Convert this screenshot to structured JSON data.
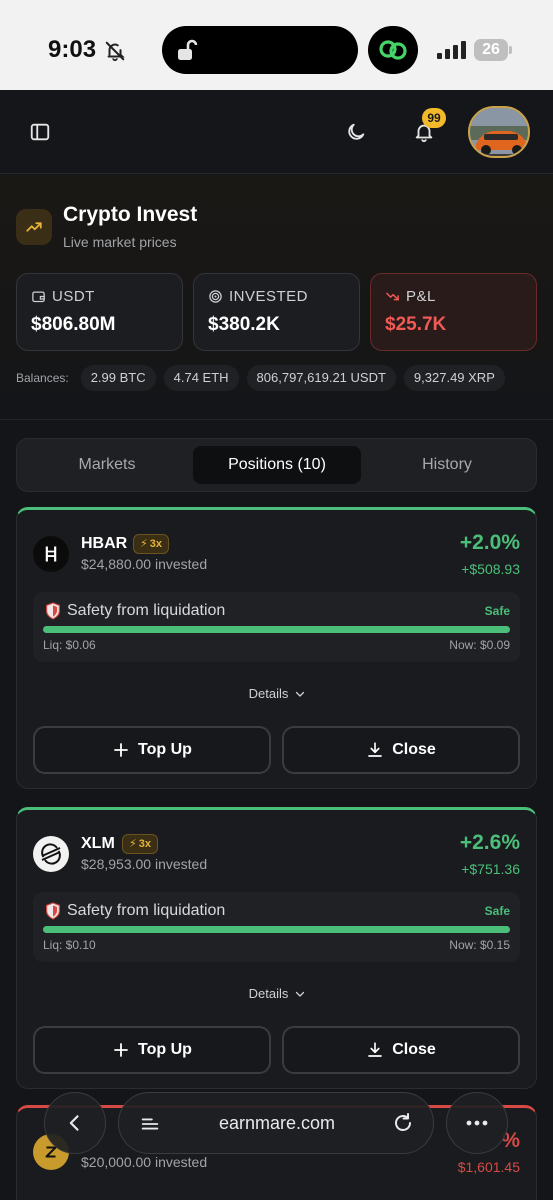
{
  "status_bar": {
    "time": "9:03",
    "battery": "26"
  },
  "header": {
    "notification_count": "99",
    "icons": [
      "sidebar-toggle-icon",
      "moon-icon",
      "bell-icon"
    ]
  },
  "brand": {
    "title": "Crypto Invest",
    "subtitle": "Live market prices"
  },
  "stats": [
    {
      "label": "USDT",
      "value": "$806.80M",
      "icon": "wallet-icon"
    },
    {
      "label": "INVESTED",
      "value": "$380.2K",
      "icon": "target-icon"
    },
    {
      "label": "P&L",
      "value": "$25.7K",
      "icon": "trend-down-icon",
      "color": "#ef5a55"
    }
  ],
  "balances": {
    "label": "Balances:",
    "items": [
      "2.99 BTC",
      "4.74 ETH",
      "806,797,619.21 USDT",
      "9,327.49 XRP"
    ]
  },
  "tabs": [
    "Markets",
    "Positions (10)",
    "History"
  ],
  "positions": [
    {
      "symbol": "HBAR",
      "leverage": "3x",
      "invested": "$24,880.00 invested",
      "pnl_pct": "+2.0%",
      "pnl_amt": "+$508.93",
      "safety_label": "Safety from liquidation",
      "safety_status": "Safe",
      "safety_level": 1.0,
      "liq": "Liq: $0.06",
      "now": "Now: $0.09",
      "details": "Details",
      "topup": "Top Up",
      "close": "Close"
    },
    {
      "symbol": "XLM",
      "leverage": "3x",
      "invested": "$28,953.00 invested",
      "pnl_pct": "+2.6%",
      "pnl_amt": "+$751.36",
      "safety_label": "Safety from liquidation",
      "safety_status": "Safe",
      "safety_level": 1.0,
      "liq": "Liq: $0.10",
      "now": "Now: $0.15",
      "details": "Details",
      "topup": "Top Up",
      "close": "Close"
    },
    {
      "symbol": "",
      "invested": "$20,000.00 invested",
      "pnl_pct": "%",
      "pnl_amt": "$1,601.45"
    }
  ],
  "browser": {
    "url": "earnmare.com"
  },
  "colors": {
    "profit": "#4bbf7a",
    "loss": "#ef5a55",
    "accent": "#e8b33a"
  }
}
